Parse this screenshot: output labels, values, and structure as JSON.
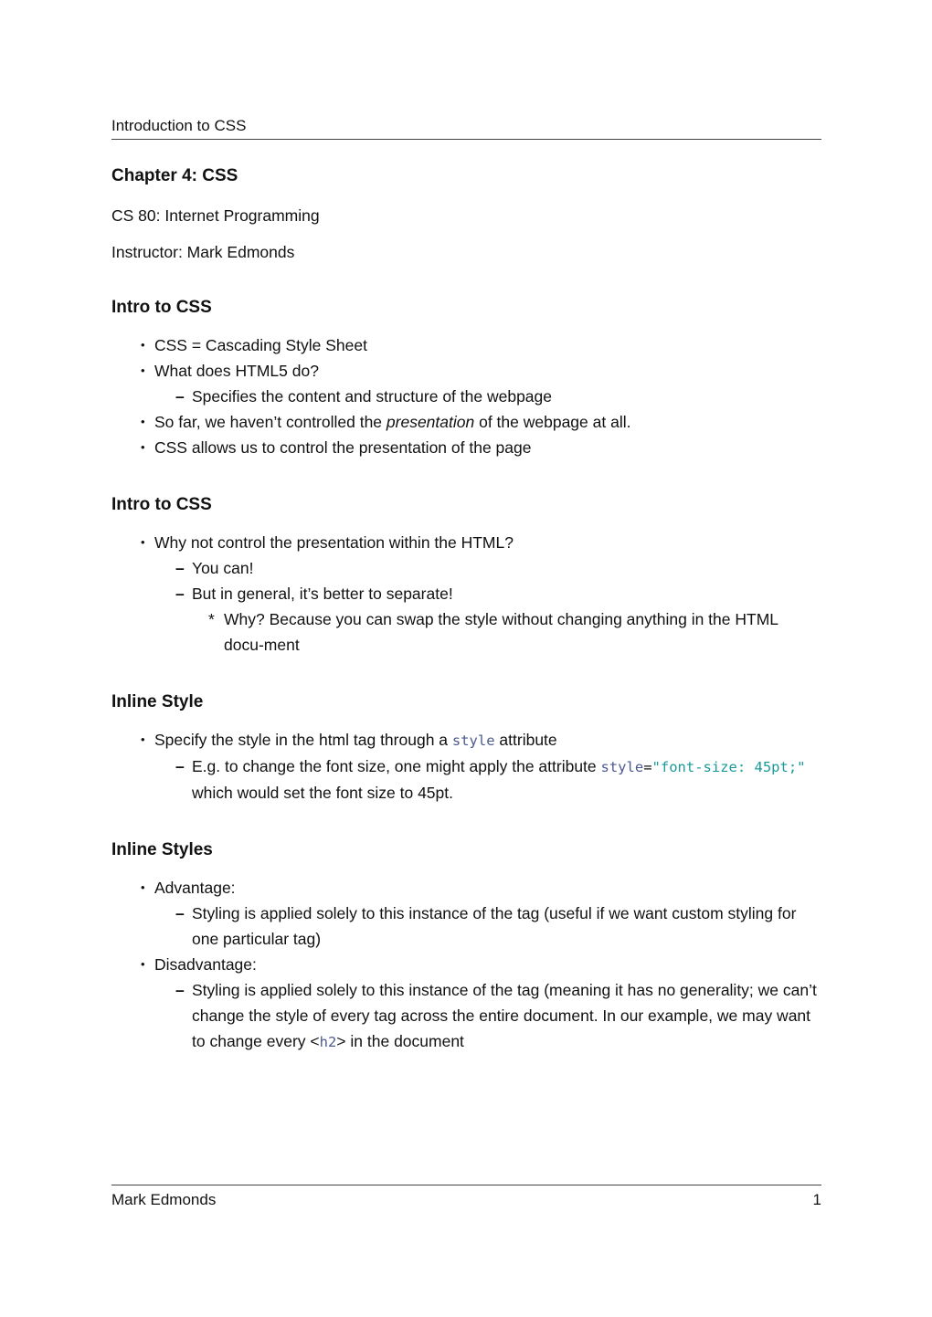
{
  "header": {
    "title": "Introduction to CSS"
  },
  "chapter": {
    "title": "Chapter 4: CSS",
    "course": "CS 80: Internet Programming",
    "instructor": "Instructor: Mark Edmonds"
  },
  "sections": [
    {
      "heading": "Intro to CSS",
      "items": {
        "a": "CSS = Cascading Style Sheet",
        "b": "What does HTML5 do?",
        "b1": "Specifies the content and structure of the webpage",
        "c_pre": "So far, we haven’t controlled the ",
        "c_em": "presentation",
        "c_post": " of the webpage at all.",
        "d": "CSS allows us to control the presentation of the page"
      }
    },
    {
      "heading": "Intro to CSS",
      "items": {
        "a": "Why not control the presentation within the HTML?",
        "a1": "You can!",
        "a2": "But in general, it’s better to separate!",
        "a2i": "Why? Because you can swap the style without changing anything in the HTML docu-ment"
      }
    },
    {
      "heading": "Inline Style",
      "items": {
        "a_pre": "Specify the style in the html tag through a ",
        "a_code": "style",
        "a_post": " attribute",
        "a1_pre": "E.g. to change the font size, one might apply the attribute ",
        "a1_code_attr": "style",
        "a1_code_eq": "=",
        "a1_code_val": "\"font-size: 45pt;\"",
        "a1_post": " which would set the font size to 45pt."
      }
    },
    {
      "heading": "Inline Styles",
      "items": {
        "a": "Advantage:",
        "a1": "Styling is applied solely to this instance of the tag (useful if we want custom styling for one particular tag)",
        "b": "Disadvantage:",
        "b1_pre": "Styling is applied solely to this instance of the tag (meaning it has no generality; we can’t change the style of every tag across the entire document. In our example, we may want to change every ",
        "b1_lt": "<",
        "b1_tag": "h2",
        "b1_gt": ">",
        "b1_post": " in the document"
      }
    }
  ],
  "footer": {
    "author": "Mark Edmonds",
    "page_number": "1"
  }
}
